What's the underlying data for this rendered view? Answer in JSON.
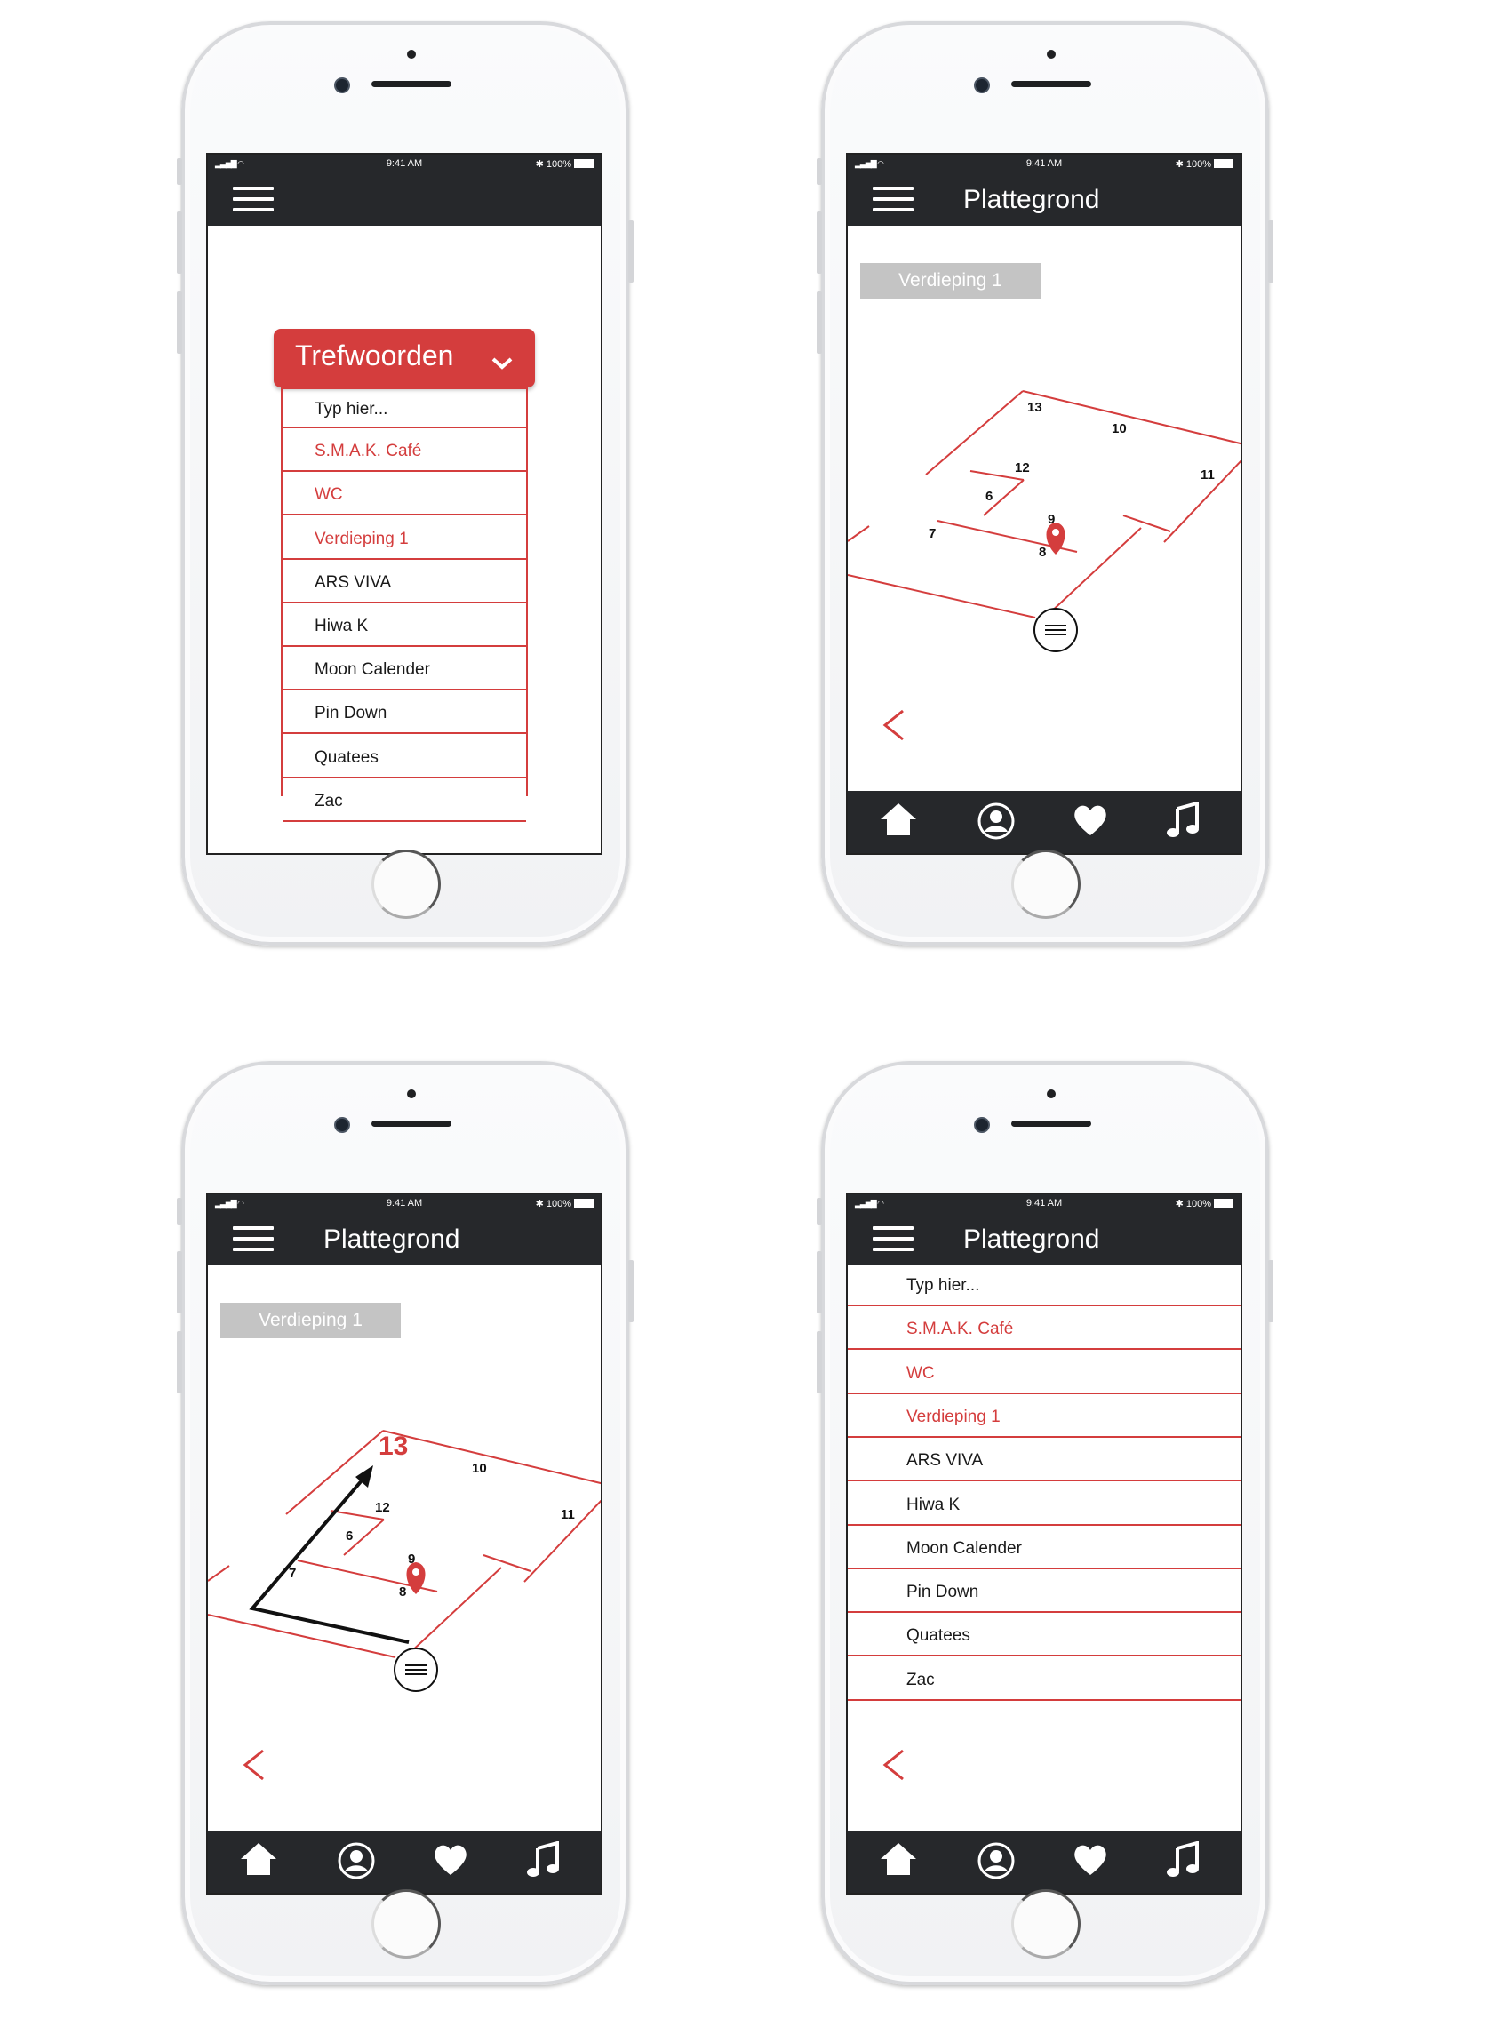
{
  "status": {
    "time": "9:41 AM",
    "battery": "100%"
  },
  "nav": {
    "title": "Plattegrond"
  },
  "dropdown": {
    "label": "Trefwoorden"
  },
  "floor_button": {
    "label": "Verdieping 1"
  },
  "search_items": [
    {
      "label": "Typ hier...",
      "highlight": false
    },
    {
      "label": "S.M.A.K. Café",
      "highlight": true
    },
    {
      "label": "WC",
      "highlight": true
    },
    {
      "label": "Verdieping 1",
      "highlight": true
    },
    {
      "label": "ARS VIVA",
      "highlight": false
    },
    {
      "label": "Hiwa K",
      "highlight": false
    },
    {
      "label": "Moon Calender",
      "highlight": false
    },
    {
      "label": "Pin Down",
      "highlight": false
    },
    {
      "label": "Quatees",
      "highlight": false
    },
    {
      "label": "Zac",
      "highlight": false
    }
  ],
  "map_rooms": [
    "13",
    "10",
    "12",
    "11",
    "6",
    "9",
    "7",
    "8"
  ],
  "tab_icons": [
    "home-icon",
    "profile-icon",
    "heart-icon",
    "music-icon"
  ],
  "colors": {
    "accent": "#d43d3d",
    "bar": "#26282b",
    "floor_button": "#c4c4c4"
  }
}
